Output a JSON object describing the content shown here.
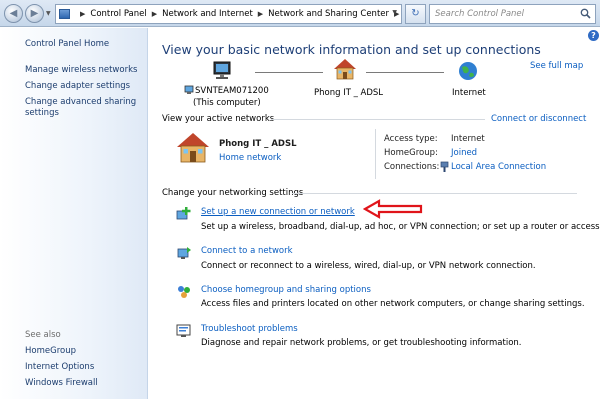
{
  "address_bar": {
    "breadcrumbs": [
      "Control Panel",
      "Network and Internet",
      "Network and Sharing Center"
    ],
    "search_placeholder": "Search Control Panel",
    "icons": {
      "back": "back-arrow-icon",
      "forward": "forward-arrow-icon",
      "refresh": "refresh-icon",
      "search": "search-icon"
    }
  },
  "sidebar": {
    "home": "Control Panel Home",
    "links": [
      "Manage wireless networks",
      "Change adapter settings",
      "Change advanced sharing settings"
    ],
    "see_also_label": "See also",
    "see_also": [
      "HomeGroup",
      "Internet Options",
      "Windows Firewall"
    ]
  },
  "main": {
    "title": "View your basic network information and set up connections",
    "see_full_map": "See full map",
    "map": {
      "computer_name": "SVNTEAM071200",
      "computer_sub": "(This computer)",
      "network_name": "Phong IT _ ADSL",
      "internet": "Internet"
    },
    "active": {
      "section_title": "View your active networks",
      "connect_disconnect": "Connect or disconnect",
      "network_name": "Phong IT _ ADSL",
      "network_type": "Home network",
      "access_type_label": "Access type:",
      "access_type_value": "Internet",
      "homegroup_label": "HomeGroup:",
      "homegroup_value": "Joined",
      "connections_label": "Connections:",
      "connections_value": "Local Area Connection"
    },
    "settings": {
      "section_title": "Change your networking settings",
      "tasks": [
        {
          "link": "Set up a new connection or network",
          "desc": "Set up a wireless, broadband, dial-up, ad hoc, or VPN connection; or set up a router or access point."
        },
        {
          "link": "Connect to a network",
          "desc": "Connect or reconnect to a wireless, wired, dial-up, or VPN network connection."
        },
        {
          "link": "Choose homegroup and sharing options",
          "desc": "Access files and printers located on other network computers, or change sharing settings."
        },
        {
          "link": "Troubleshoot problems",
          "desc": "Diagnose and repair network problems, or get troubleshooting information."
        }
      ]
    },
    "help_label": "?"
  },
  "colors": {
    "link": "#0b5ec1",
    "title": "#1e3f77",
    "arrow": "#e0141a"
  }
}
